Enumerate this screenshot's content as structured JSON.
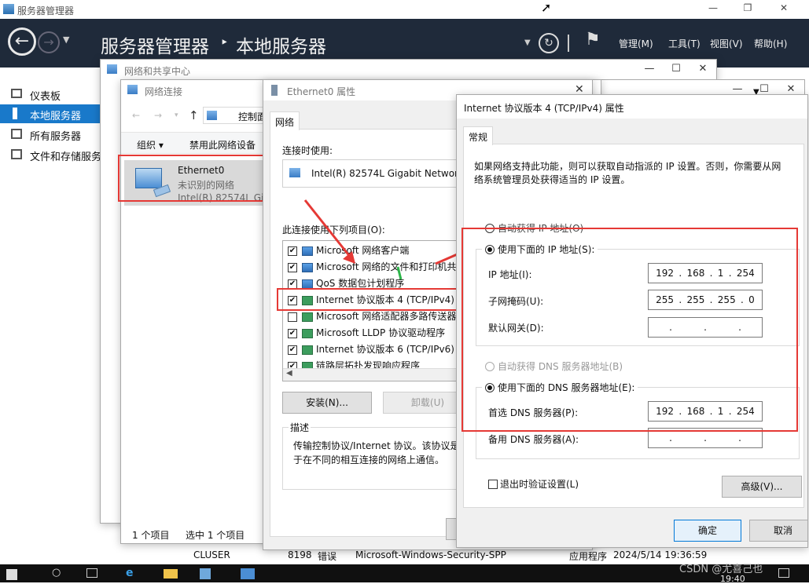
{
  "server_manager": {
    "window_title": "服务器管理器",
    "breadcrumb_root": "服务器管理器",
    "breadcrumb_sep": "‣",
    "breadcrumb_current": "本地服务器",
    "menu": [
      "管理(M)",
      "工具(T)",
      "视图(V)",
      "帮助(H)"
    ],
    "sidebar": [
      "仪表板",
      "本地服务器",
      "所有服务器",
      "文件和存储服务"
    ],
    "event_row": [
      "CLUSER",
      "8198",
      "错误",
      "Microsoft-Windows-Security-SPP",
      "应用程序",
      "2024/5/14 19:36:59"
    ]
  },
  "network_center": {
    "title": "网络和共享中心"
  },
  "network_connections": {
    "title": "网络连接",
    "address": "控制面",
    "organize": "组织 ▾",
    "disable": "禁用此网络设备",
    "adapter_name": "Ethernet0",
    "adapter_status": "未识别的网络",
    "adapter_device": "Intel(R) 82574L Gig",
    "status_items": "1 个项目",
    "status_selected": "选中 1 个项目"
  },
  "ethernet_props": {
    "title": "Ethernet0 属性",
    "tab": "网络",
    "connect_using_label": "连接时使用:",
    "adapter": "Intel(R) 82574L Gigabit Network",
    "items_label": "此连接使用下列项目(O):",
    "items": [
      "Microsoft 网络客户端",
      "Microsoft 网络的文件和打印机共",
      "QoS 数据包计划程序",
      "Internet 协议版本 4 (TCP/IPv4)",
      "Microsoft 网络适配器多路传送器",
      "Microsoft LLDP 协议驱动程序",
      "Internet 协议版本 6 (TCP/IPv6)",
      "链路层拓扑发现响应程序"
    ],
    "install": "安装(N)...",
    "uninstall": "卸载(U)",
    "desc_title": "描述",
    "desc_text_1": "传输控制协议/Internet 协议。该协议是",
    "desc_text_2": "于在不同的相互连接的网络上通信。"
  },
  "ipv4_props": {
    "title": "Internet 协议版本 4 (TCP/IPv4) 属性",
    "tab": "常规",
    "intro_1": "如果网络支持此功能，则可以获取自动指派的 IP 设置。否则，你需要从网",
    "intro_2": "络系统管理员处获得适当的 IP 设置。",
    "auto_ip": "自动获得 IP 地址(O)",
    "manual_ip": "使用下面的 IP 地址(S):",
    "ip_label": "IP 地址(I):",
    "ip": [
      "192",
      "168",
      "1",
      "254"
    ],
    "mask_label": "子网掩码(U):",
    "mask": [
      "255",
      "255",
      "255",
      "0"
    ],
    "gateway_label": "默认网关(D):",
    "auto_dns": "自动获得 DNS 服务器地址(B)",
    "manual_dns": "使用下面的 DNS 服务器地址(E):",
    "dns1_label": "首选 DNS 服务器(P):",
    "dns1": [
      "192",
      "168",
      "1",
      "254"
    ],
    "dns2_label": "备用 DNS 服务器(A):",
    "validate": "退出时验证设置(L)",
    "advanced": "高级(V)...",
    "ok": "确定",
    "cancel": "取消"
  },
  "taskbar": {
    "clock": "19:40",
    "watermark": "CSDN @尤喜己也"
  }
}
